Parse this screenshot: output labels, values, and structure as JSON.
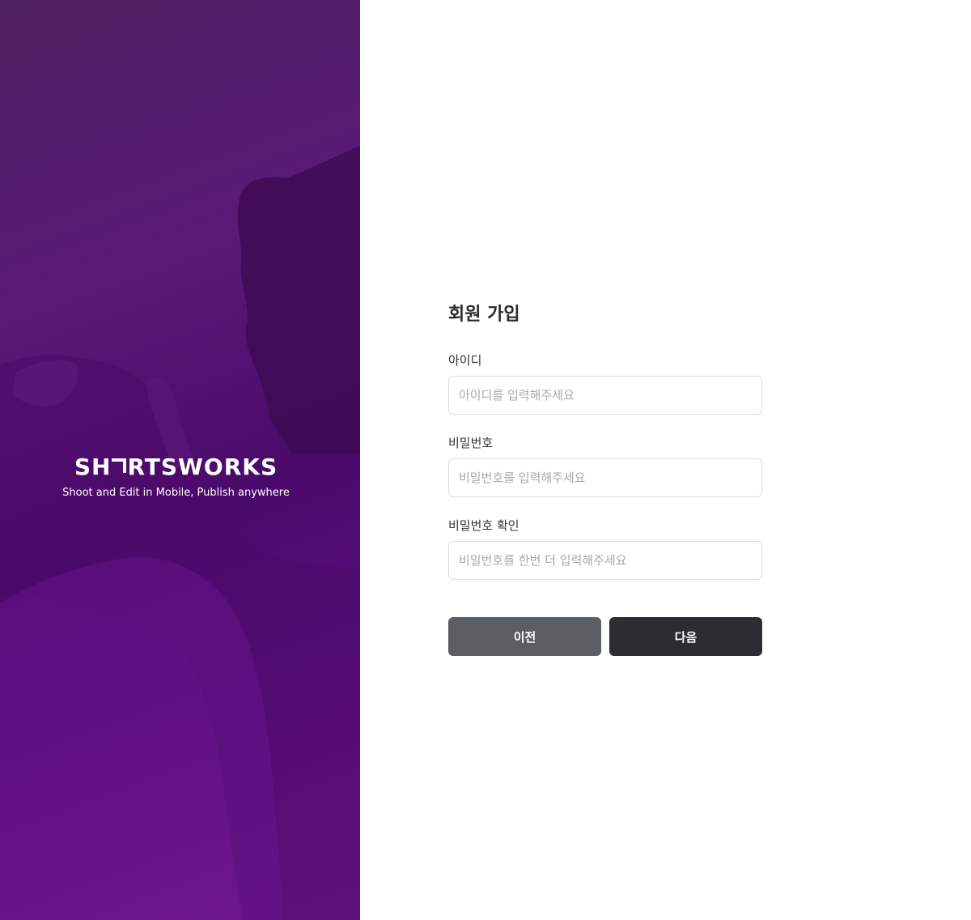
{
  "brand": {
    "logo_part1": "SH",
    "logo_part2": "RTSWORKS",
    "tagline": "Shoot and Edit in Mobile, Publish anywhere"
  },
  "form": {
    "title": "회원 가입",
    "fields": [
      {
        "label": "아이디",
        "placeholder": "아이디를 입력해주세요",
        "value": ""
      },
      {
        "label": "비밀번호",
        "placeholder": "비밀번호를 입력해주세요",
        "value": ""
      },
      {
        "label": "비밀번호 확인",
        "placeholder": "비밀번호를 한번 더 입력해주세요",
        "value": ""
      }
    ],
    "buttons": {
      "prev_label": "이전",
      "next_label": "다음"
    }
  },
  "colors": {
    "brand_purple": "#5a0f7e",
    "prev_button": "#5b5e63",
    "next_button": "#2c2d30"
  }
}
